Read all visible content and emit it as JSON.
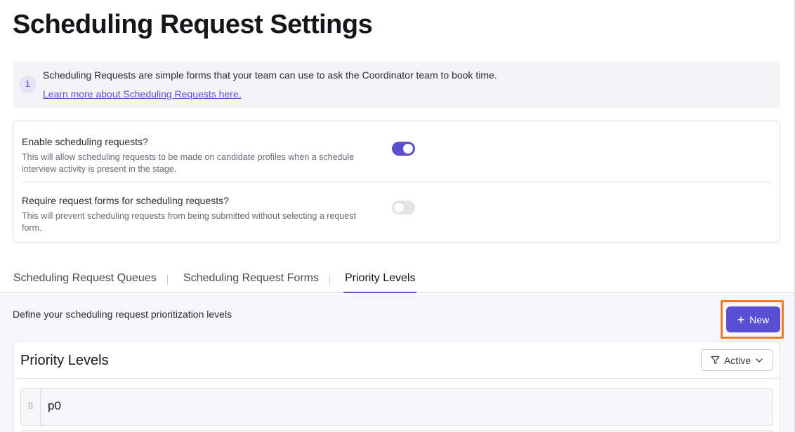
{
  "page": {
    "title": "Scheduling Request Settings"
  },
  "info_banner": {
    "icon": "info-icon",
    "icon_glyph": "i",
    "text": "Scheduling Requests are simple forms that your team can use to ask the Coordinator team to book time.",
    "link_text": "Learn more about Scheduling Requests here."
  },
  "settings": [
    {
      "label": "Enable scheduling requests?",
      "description": "This will allow scheduling requests to be made on candidate profiles when a schedule interview activity is present in the stage.",
      "enabled": true
    },
    {
      "label": "Require request forms for scheduling requests?",
      "description": "This will prevent scheduling requests from being submitted without selecting a request form.",
      "enabled": false
    }
  ],
  "tabs": [
    {
      "label": "Scheduling Request Queues",
      "active": false
    },
    {
      "label": "Scheduling Request Forms",
      "active": false
    },
    {
      "label": "Priority Levels",
      "active": true
    }
  ],
  "priority_section": {
    "description": "Define your scheduling request prioritization levels",
    "new_button": {
      "icon": "plus-icon",
      "glyph": "+",
      "label": "New"
    },
    "card_title": "Priority Levels",
    "filter": {
      "icon": "filter-icon",
      "label": "Active",
      "chevron_icon": "chevron-down-icon"
    },
    "levels": [
      {
        "name": "p0",
        "drag_glyph": "⠿"
      }
    ]
  },
  "colors": {
    "accent": "#5a4fd0",
    "highlight": "#ef7a2c"
  }
}
